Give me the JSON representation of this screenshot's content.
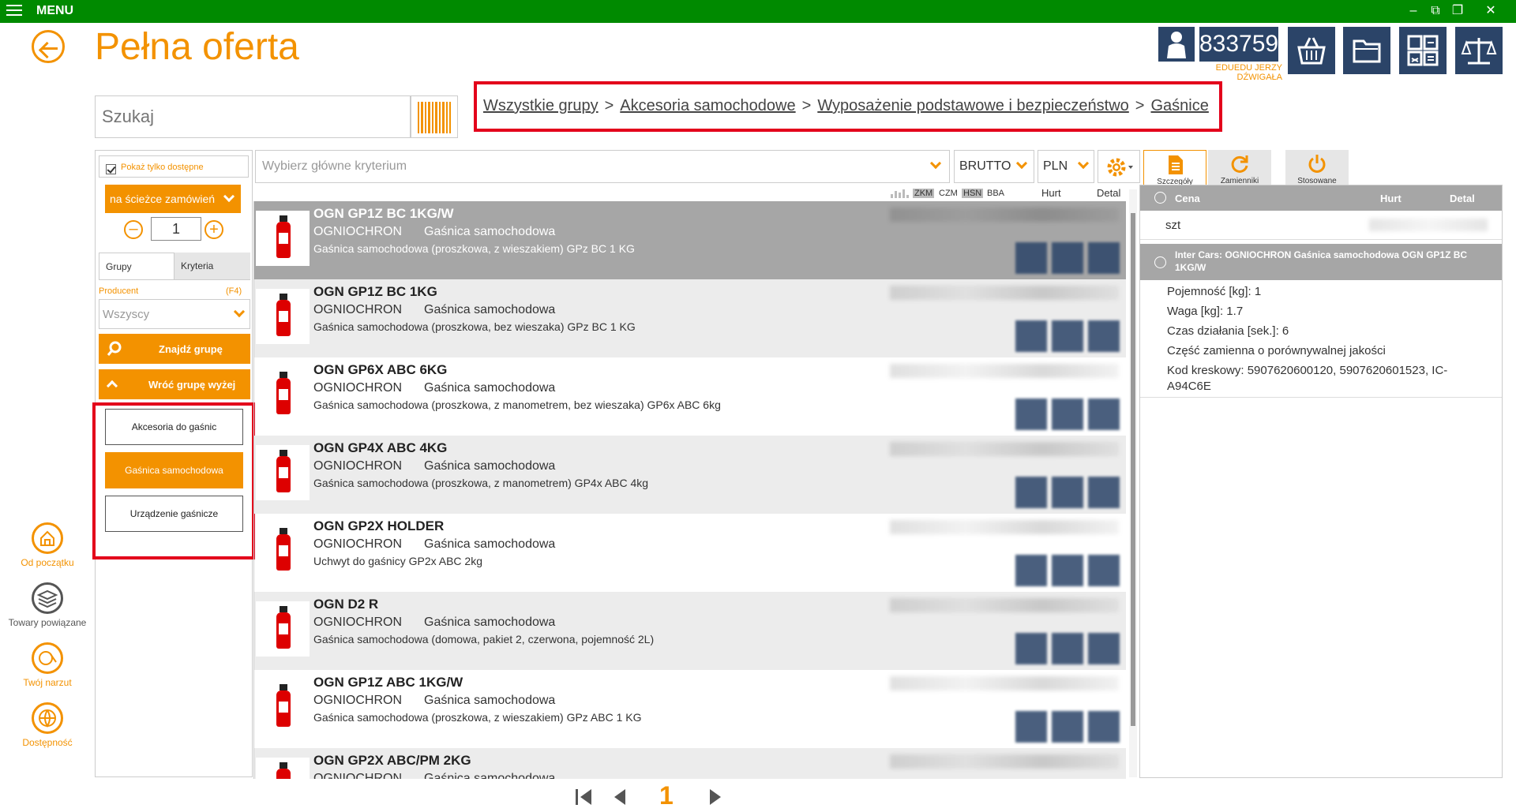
{
  "topbar": {
    "menu_label": "MENU"
  },
  "page": {
    "title": "Pełna oferta"
  },
  "search": {
    "placeholder": "Szukaj"
  },
  "breadcrumb": [
    "Wszystkie grupy",
    "Akcesoria samochodowe",
    "Wyposażenie podstawowe i bezpieczeństwo",
    "Gaśnice"
  ],
  "breadcrumb_sep": ">",
  "client": {
    "number": "833759",
    "name": "EDUEDU JERZY DŹWIGAŁA"
  },
  "left_panel": {
    "only_available": "Pokaż tylko dostępne",
    "order_path": "na ścieżce zamówień",
    "quantity": "1",
    "tab_groups": "Grupy",
    "tab_criteria": "Kryteria",
    "producer_label": "Producent",
    "producer_hotkey": "(F4)",
    "producer_value": "Wszyscy",
    "find_group": "Znajdź grupę",
    "group_up": "Wróć grupę wyżej",
    "groups": [
      "Akcesoria do gaśnic",
      "Gaśnica samochodowa",
      "Urządzenie gaśnicze"
    ],
    "active_group": "Gaśnica samochodowa"
  },
  "sidebar": [
    {
      "label": "Od początku",
      "icon": "home-icon"
    },
    {
      "label": "Towary powiązane",
      "icon": "layers-icon"
    },
    {
      "label": "Twój narzut",
      "icon": "money-icon"
    },
    {
      "label": "Dostępność",
      "icon": "globe-icon"
    }
  ],
  "toolbar": {
    "criteria_placeholder": "Wybierz główne kryterium",
    "price_mode": "BRUTTO",
    "currency": "PLN",
    "tabs": [
      "Szczegóły",
      "Zamienniki",
      "Stosowane"
    ]
  },
  "columns": {
    "mini": [
      "ZKM",
      "CZM",
      "HSN",
      "BBA"
    ],
    "hurt": "Hurt",
    "detal": "Detal"
  },
  "products": [
    {
      "title": "OGN GP1Z BC 1KG/W",
      "brand": "OGNIOCHRON",
      "category": "Gaśnica samochodowa",
      "desc": "Gaśnica samochodowa (proszkowa, z wieszakiem) GPz BC 1 KG"
    },
    {
      "title": "OGN GP1Z BC 1KG",
      "brand": "OGNIOCHRON",
      "category": "Gaśnica samochodowa",
      "desc": "Gaśnica samochodowa (proszkowa, bez wieszaka) GPz BC 1 KG"
    },
    {
      "title": "OGN GP6X ABC 6KG",
      "brand": "OGNIOCHRON",
      "category": "Gaśnica samochodowa",
      "desc": "Gaśnica samochodowa (proszkowa, z manometrem, bez wieszaka) GP6x ABC 6kg"
    },
    {
      "title": "OGN GP4X ABC 4KG",
      "brand": "OGNIOCHRON",
      "category": "Gaśnica samochodowa",
      "desc": "Gaśnica samochodowa (proszkowa, z manometrem) GP4x ABC 4kg"
    },
    {
      "title": "OGN GP2X HOLDER",
      "brand": "OGNIOCHRON",
      "category": "Gaśnica samochodowa",
      "desc": "Uchwyt do gaśnicy GP2x ABC 2kg"
    },
    {
      "title": "OGN D2 R",
      "brand": "OGNIOCHRON",
      "category": "Gaśnica samochodowa",
      "desc": "Gaśnica samochodowa (domowa, pakiet 2, czerwona, pojemność 2L)"
    },
    {
      "title": "OGN GP1Z ABC 1KG/W",
      "brand": "OGNIOCHRON",
      "category": "Gaśnica samochodowa",
      "desc": "Gaśnica samochodowa (proszkowa, z wieszakiem) GPz ABC 1 KG"
    },
    {
      "title": "OGN GP2X ABC/PM 2KG",
      "brand": "OGNIOCHRON",
      "category": "Gaśnica samochodowa",
      "desc": ""
    }
  ],
  "detail": {
    "header": {
      "cena": "Cena",
      "hurt": "Hurt",
      "detal": "Detal"
    },
    "unit": "szt",
    "product_title": "Inter Cars: OGNIOCHRON Gaśnica samochodowa OGN GP1Z BC 1KG/W",
    "attributes": [
      "Pojemność [kg]: 1",
      "Waga [kg]: 1.7",
      "Czas działania [sek.]: 6",
      "Część zamienna o porównywalnej jakości",
      "Kod kreskowy: 5907620600120, 5907620601523, IC-",
      "A94C6E"
    ]
  },
  "pagination": {
    "current": "1"
  },
  "colors": {
    "accent": "#f39200",
    "topbar": "#008a00",
    "highlight": "#e3001b",
    "navy": "#2b4468"
  }
}
